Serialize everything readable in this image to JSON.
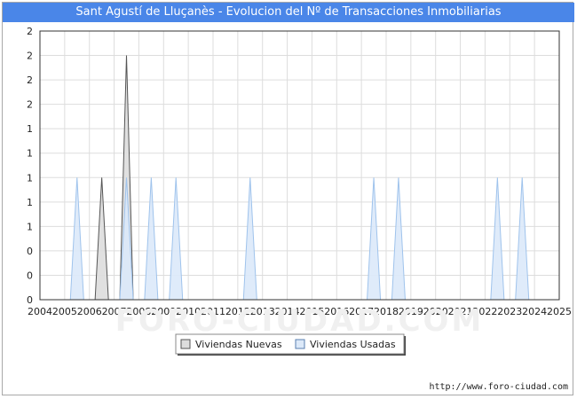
{
  "header": {
    "title": "Sant Agustí de Lluçanès - Evolucion del Nº de Transacciones Inmobiliarias"
  },
  "footer": {
    "url": "http://www.foro-ciudad.com"
  },
  "chart_data": {
    "type": "area",
    "x": [
      2004,
      2005,
      2006,
      2007,
      2008,
      2009,
      2010,
      2011,
      2012,
      2013,
      2014,
      2015,
      2016,
      2017,
      2018,
      2019,
      2020,
      2021,
      2022,
      2023,
      2024,
      2025
    ],
    "x_tick_labels": [
      "2004",
      "2005",
      "2006",
      "2007",
      "2008",
      "2009",
      "2010",
      "2011",
      "2012",
      "2013",
      "2014",
      "2015",
      "2016",
      "2017",
      "2018",
      "2019",
      "2020",
      "2021",
      "2022",
      "2023",
      "2024",
      "2025"
    ],
    "y_tick_labels": [
      "0",
      "0",
      "0",
      "1",
      "1",
      "1",
      "1",
      "1",
      "2",
      "2",
      "2",
      "2"
    ],
    "ylim": [
      0,
      2.2
    ],
    "grid": true,
    "legend_position": "bottom-center",
    "series": [
      {
        "name": "Viviendas Nuevas",
        "color": "#555555",
        "fill": "#dddddd",
        "values": [
          0,
          0,
          1,
          2,
          0,
          0,
          0,
          0,
          0,
          0,
          0,
          0,
          0,
          0,
          0,
          0,
          0,
          0,
          0,
          0,
          0,
          0
        ]
      },
      {
        "name": "Viviendas Usadas",
        "color": "#9fc3ec",
        "fill": "#dce9f9",
        "values": [
          0,
          1,
          0,
          1,
          1,
          1,
          0,
          0,
          1,
          0,
          0,
          0,
          0,
          1,
          1,
          0,
          0,
          0,
          1,
          1,
          0,
          0
        ]
      }
    ]
  },
  "watermark": "FORO-CIUDAD.COM"
}
